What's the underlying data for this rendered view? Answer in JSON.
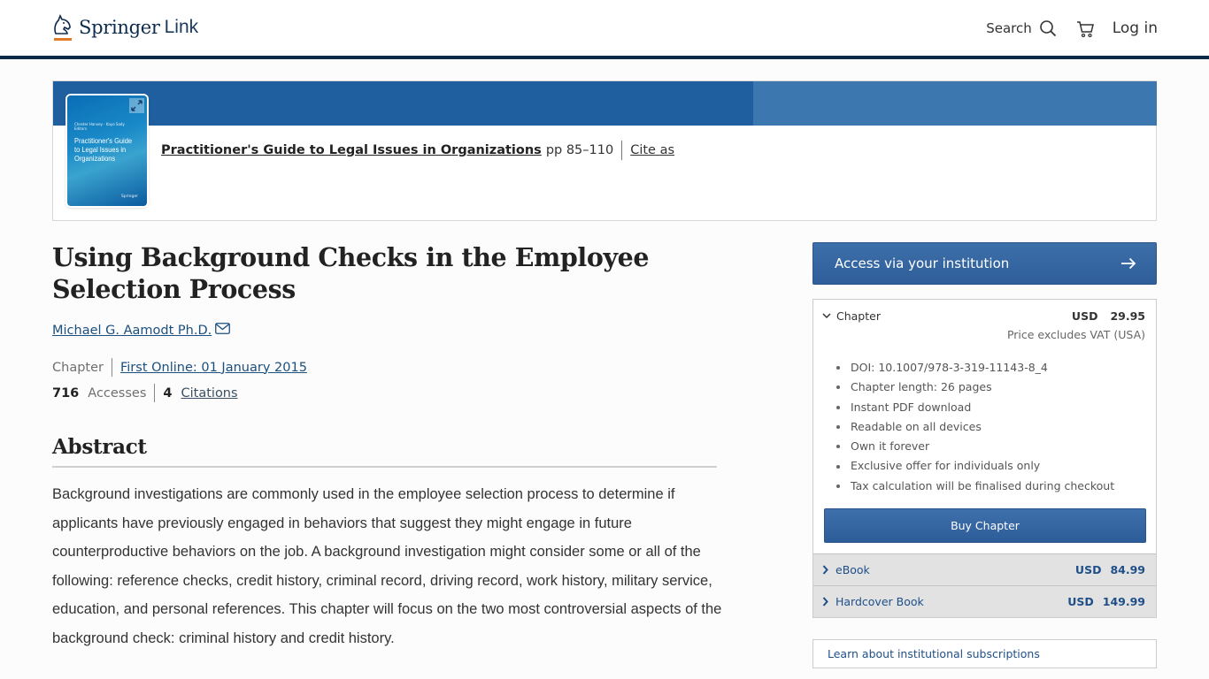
{
  "header": {
    "logo_brand": "Springer",
    "logo_product": "Link",
    "search_label": "Search",
    "login_label": "Log in",
    "brand_colors": {
      "navy": "#0b2a4a",
      "orange": "#e07b24",
      "blue": "#1f5fa0"
    }
  },
  "book": {
    "cover": {
      "title": "Practitioner's Guide to Legal Issues in Organizations",
      "editors": "Chester Hanvey · Kayo Sady   Editors",
      "publisher": "Springer"
    },
    "title": "Practitioner's Guide to Legal Issues in Organizations",
    "pages": "pp 85–110",
    "cite_label": "Cite as"
  },
  "chapter": {
    "title": "Using Background Checks in the Employee Selection Process",
    "author": "Michael G. Aamodt Ph.D.",
    "type": "Chapter",
    "first_online": "First Online: 01 January 2015",
    "accesses_count": "716",
    "accesses_label": "Accesses",
    "citations_count": "4",
    "citations_label": "Citations"
  },
  "abstract": {
    "heading": "Abstract",
    "text": "Background investigations are commonly used in the employee selection process to determine if applicants have previously engaged in behaviors that suggest they might engage in future counterproductive behaviors on the job. A background investigation might consider some or all of the following: reference checks, credit history, criminal record, driving record, work history, military service, education, and personal references. This chapter will focus on the two most controversial aspects of the background check: criminal history and credit history."
  },
  "sidebar": {
    "access_button": "Access via your institution",
    "chapter_option": {
      "label": "Chapter",
      "currency": "USD",
      "price": "29.95",
      "vat_note": "Price excludes VAT (USA)",
      "features": [
        "DOI: 10.1007/978-3-319-11143-8_4",
        "Chapter length: 26 pages",
        "Instant PDF download",
        "Readable on all devices",
        "Own it forever",
        "Exclusive offer for individuals only",
        "Tax calculation will be finalised during checkout"
      ],
      "buy_button": "Buy Chapter"
    },
    "other_options": [
      {
        "label": "eBook",
        "currency": "USD",
        "price": "84.99"
      },
      {
        "label": "Hardcover Book",
        "currency": "USD",
        "price": "149.99"
      }
    ],
    "subscriptions_link": "Learn about institutional subscriptions"
  }
}
